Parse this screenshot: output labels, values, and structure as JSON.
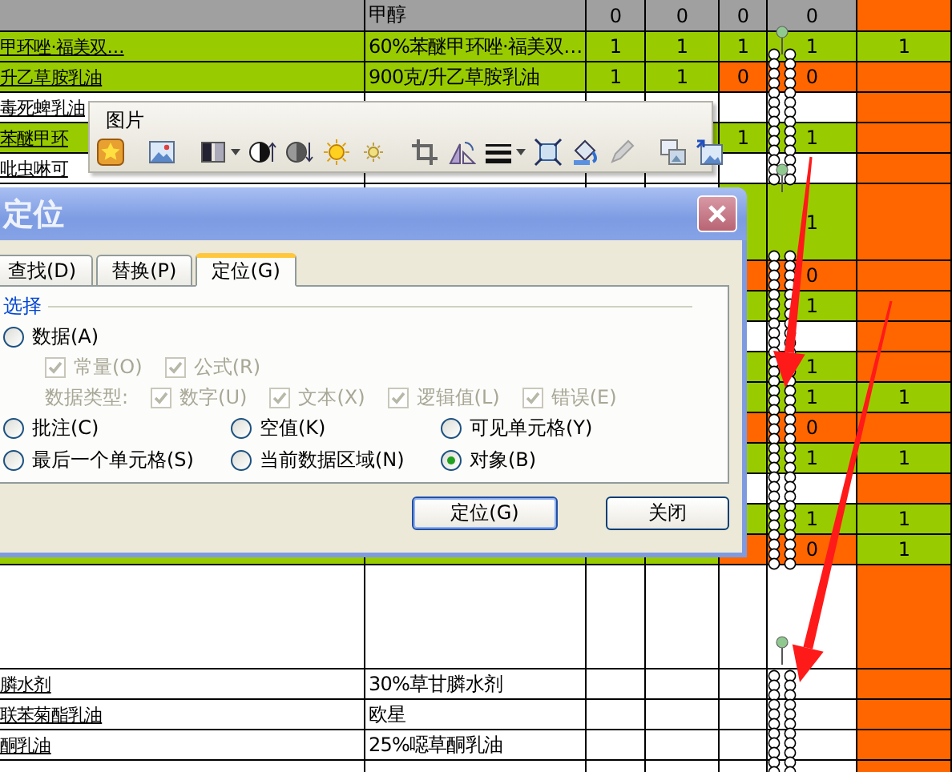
{
  "sheet": {
    "rows": [
      {
        "kind": "header",
        "cells": [
          {
            "color": "#a0a0a0"
          },
          {
            "text": "甲醇",
            "color": "#a0a0a0"
          },
          {
            "text": "0",
            "color": "#a0a0a0"
          },
          {
            "text": "0",
            "color": "#a0a0a0"
          },
          {
            "text": "0",
            "color": "#a0a0a0"
          },
          {
            "text": "0",
            "color": "#a0a0a0"
          },
          {
            "color": "#ff6600"
          }
        ]
      },
      {
        "kind": "row",
        "cells": [
          {
            "text": "甲环唑·福美双…",
            "color": "#99cc00"
          },
          {
            "text": "60%苯醚甲环唑·福美双…",
            "color": "#99cc00"
          },
          {
            "text": "1",
            "color": "#99cc00"
          },
          {
            "text": "1",
            "color": "#99cc00"
          },
          {
            "text": "1",
            "color": "#99cc00"
          },
          {
            "text": "1",
            "color": "#99cc00"
          },
          {
            "text": "1",
            "color": "#99cc00"
          }
        ]
      },
      {
        "kind": "row",
        "cells": [
          {
            "text": "升乙草胺乳油",
            "color": "#99cc00"
          },
          {
            "text": "900克/升乙草胺乳油",
            "color": "#99cc00"
          },
          {
            "text": "1",
            "color": "#99cc00"
          },
          {
            "text": "1",
            "color": "#99cc00"
          },
          {
            "text": "0",
            "color": "#ff6600"
          },
          {
            "text": "0",
            "color": "#ff6600"
          },
          {
            "color": "#ff6600"
          }
        ]
      },
      {
        "kind": "row",
        "cells": [
          {
            "text": "毒死蜱乳油",
            "color": "#ffffff"
          },
          {
            "color": "#ffffff"
          },
          {
            "color": "#ffffff"
          },
          {
            "color": "#ffffff"
          },
          {
            "color": "#ffffff"
          },
          {
            "color": "#ffffff"
          },
          {
            "color": "#ff6600"
          }
        ]
      },
      {
        "kind": "row",
        "cells": [
          {
            "text": "苯醚甲环",
            "color": "#99cc00"
          },
          {},
          {},
          {
            "color": "#99cc00"
          },
          {
            "text": "1",
            "color": "#99cc00"
          },
          {
            "text": "1",
            "color": "#99cc00"
          },
          {
            "color": "#ff6600"
          }
        ]
      },
      {
        "kind": "row",
        "cells": [
          {
            "text": "吡虫啉可",
            "color": "#ffffff"
          },
          {
            "color": "#ffffff"
          },
          {
            "color": "#ffffff"
          },
          {
            "color": "#ffffff"
          },
          {
            "color": "#ffffff"
          },
          {
            "color": "#ffffff"
          },
          {
            "color": "#ff6600"
          }
        ]
      },
      {
        "kind": "double",
        "cells": [
          {},
          {},
          {},
          {},
          {
            "color": "#99cc00"
          },
          {
            "text": "1",
            "color": "#99cc00"
          },
          {
            "color": "#ff6600"
          }
        ]
      },
      {
        "kind": "row",
        "cells": [
          {},
          {},
          {},
          {},
          {
            "color": "#ff6600"
          },
          {
            "text": "0",
            "color": "#ff6600"
          },
          {
            "color": "#ff6600"
          }
        ]
      },
      {
        "kind": "row",
        "cells": [
          {},
          {},
          {},
          {},
          {
            "color": "#99cc00"
          },
          {
            "text": "1",
            "color": "#99cc00"
          },
          {
            "color": "#ff6600"
          }
        ]
      },
      {
        "kind": "row",
        "cells": [
          {},
          {},
          {},
          {},
          {
            "color": "#ffffff"
          },
          {
            "color": "#ffffff"
          },
          {
            "color": "#ff6600"
          }
        ]
      },
      {
        "kind": "row",
        "cells": [
          {},
          {},
          {},
          {},
          {
            "color": "#99cc00"
          },
          {
            "text": "1",
            "color": "#99cc00"
          },
          {
            "color": "#ff6600"
          }
        ]
      },
      {
        "kind": "row",
        "cells": [
          {},
          {},
          {},
          {},
          {
            "color": "#99cc00"
          },
          {
            "text": "1",
            "color": "#99cc00"
          },
          {
            "text": "1",
            "color": "#99cc00"
          }
        ]
      },
      {
        "kind": "row",
        "cells": [
          {},
          {},
          {},
          {},
          {
            "color": "#ff6600"
          },
          {
            "text": "0",
            "color": "#ff6600"
          },
          {
            "color": "#ff6600"
          }
        ]
      },
      {
        "kind": "row",
        "cells": [
          {},
          {},
          {},
          {},
          {
            "color": "#99cc00"
          },
          {
            "text": "1",
            "color": "#99cc00"
          },
          {
            "text": "1",
            "color": "#99cc00"
          }
        ]
      },
      {
        "kind": "row",
        "cells": [
          {},
          {},
          {},
          {},
          {
            "color": "#ffffff"
          },
          {
            "color": "#ffffff"
          },
          {
            "color": "#ff6600"
          }
        ]
      },
      {
        "kind": "row",
        "cells": [
          {},
          {},
          {},
          {},
          {
            "color": "#99cc00"
          },
          {
            "text": "1",
            "color": "#99cc00"
          },
          {
            "text": "1",
            "color": "#99cc00"
          }
        ]
      },
      {
        "kind": "row",
        "cells": [
          {
            "color": "#99cc00"
          },
          {
            "color": "#99cc00"
          },
          {
            "color": "#99cc00"
          },
          {
            "color": "#99cc00"
          },
          {
            "color": "#ff6600"
          },
          {
            "text": "0",
            "color": "#ff6600"
          },
          {
            "text": "1",
            "color": "#99cc00"
          }
        ]
      },
      {
        "kind": "triple",
        "cells": [
          {
            "color": "#ffffff"
          },
          {
            "color": "#ffffff"
          },
          {
            "color": "#ffffff"
          },
          {
            "color": "#ffffff"
          },
          {
            "color": "#ffffff"
          },
          {
            "color": "#ffffff"
          },
          {
            "color": "#ff6600"
          }
        ]
      },
      {
        "kind": "row",
        "cells": [
          {
            "text": "膦水剂",
            "color": "#ffffff"
          },
          {
            "text": "30%草甘膦水剂",
            "color": "#ffffff"
          },
          {
            "color": "#ffffff"
          },
          {
            "color": "#ffffff"
          },
          {
            "color": "#ffffff"
          },
          {
            "color": "#ffffff"
          },
          {
            "color": "#ff6600"
          }
        ]
      },
      {
        "kind": "row",
        "cells": [
          {
            "text": "联苯菊酯乳油",
            "color": "#ffffff"
          },
          {
            "text": "欧星",
            "color": "#ffffff"
          },
          {
            "color": "#ffffff"
          },
          {
            "color": "#ffffff"
          },
          {
            "color": "#ffffff"
          },
          {
            "color": "#ffffff"
          },
          {
            "color": "#ff6600"
          }
        ]
      },
      {
        "kind": "row",
        "cells": [
          {
            "text": "酮乳油",
            "color": "#ffffff"
          },
          {
            "text": "25%噁草酮乳油",
            "color": "#ffffff"
          },
          {
            "color": "#ffffff"
          },
          {
            "color": "#ffffff"
          },
          {
            "color": "#ffffff"
          },
          {
            "color": "#ffffff"
          },
          {
            "color": "#ff6600"
          }
        ]
      },
      {
        "kind": "row",
        "cells": [
          {
            "color": "#ffffff"
          },
          {
            "color": "#ffffff"
          },
          {
            "color": "#ffffff"
          },
          {
            "color": "#ffffff"
          },
          {
            "color": "#ffffff"
          },
          {
            "color": "#ffffff"
          },
          {
            "color": "#ff6600"
          }
        ]
      }
    ]
  },
  "toolbar": {
    "title": "图片"
  },
  "dialog": {
    "title": "定位",
    "tabs": [
      {
        "label": "查找(D)",
        "selected": false
      },
      {
        "label": "替换(P)",
        "selected": false
      },
      {
        "label": "定位(G)",
        "selected": true
      }
    ],
    "group": "选择",
    "data_option": {
      "label": "数据(A)",
      "selected": false
    },
    "data_checks": [
      {
        "label": "常量(O)",
        "checked": true,
        "disabled": true
      },
      {
        "label": "公式(R)",
        "checked": true,
        "disabled": true
      }
    ],
    "type_label": "数据类型:",
    "type_checks": [
      {
        "label": "数字(U)",
        "checked": true,
        "disabled": true
      },
      {
        "label": "文本(X)",
        "checked": true,
        "disabled": true
      },
      {
        "label": "逻辑值(L)",
        "checked": true,
        "disabled": true
      },
      {
        "label": "错误(E)",
        "checked": true,
        "disabled": true
      }
    ],
    "options": [
      {
        "label": "批注(C)",
        "selected": false
      },
      {
        "label": "空值(K)",
        "selected": false
      },
      {
        "label": "可见单元格(Y)",
        "selected": false
      },
      {
        "label": "最后一个单元格(S)",
        "selected": false
      },
      {
        "label": "当前数据区域(N)",
        "selected": false
      },
      {
        "label": "对象(B)",
        "selected": true
      }
    ],
    "buttons": [
      {
        "label": "定位(G)",
        "default": true
      },
      {
        "label": "关闭",
        "default": false
      }
    ]
  }
}
